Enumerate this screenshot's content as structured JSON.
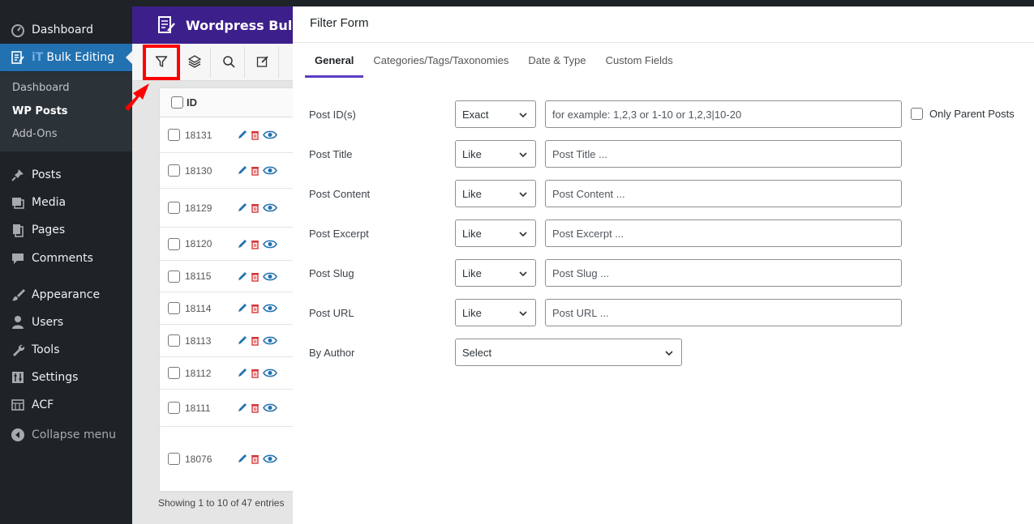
{
  "sidebar": {
    "items": [
      {
        "label": "Dashboard",
        "icon": "dashboard-icon"
      },
      {
        "badge": "iT",
        "label": "Bulk Editing",
        "icon": "bulk-edit-icon"
      },
      {
        "label": "Posts",
        "icon": "pin-icon"
      },
      {
        "label": "Media",
        "icon": "media-icon"
      },
      {
        "label": "Pages",
        "icon": "pages-icon"
      },
      {
        "label": "Comments",
        "icon": "comments-icon"
      },
      {
        "label": "Appearance",
        "icon": "brush-icon"
      },
      {
        "label": "Users",
        "icon": "user-icon"
      },
      {
        "label": "Tools",
        "icon": "wrench-icon"
      },
      {
        "label": "Settings",
        "icon": "settings-icon"
      },
      {
        "label": "ACF",
        "icon": "acf-icon"
      }
    ],
    "submenu": [
      "Dashboard",
      "WP Posts",
      "Add-Ons"
    ],
    "collapse_label": "Collapse menu"
  },
  "plugin": {
    "title": "Wordpress Bulk Po",
    "table_header": "ID",
    "rows": [
      {
        "id": "18131"
      },
      {
        "id": "18130"
      },
      {
        "id": "18129"
      },
      {
        "id": "18120"
      },
      {
        "id": "18115"
      },
      {
        "id": "18114"
      },
      {
        "id": "18113"
      },
      {
        "id": "18112"
      },
      {
        "id": "18111"
      },
      {
        "id": "18076"
      }
    ],
    "showing": "Showing 1 to 10 of 47 entries"
  },
  "modal": {
    "title": "Filter Form",
    "tabs": [
      "General",
      "Categories/Tags/Taxonomies",
      "Date & Type",
      "Custom Fields"
    ],
    "fields": [
      {
        "label": "Post ID(s)",
        "operator": "Exact",
        "placeholder": "for example: 1,2,3 or 1-10 or 1,2,3|10-20"
      },
      {
        "label": "Post Title",
        "operator": "Like",
        "placeholder": "Post Title ..."
      },
      {
        "label": "Post Content",
        "operator": "Like",
        "placeholder": "Post Content ..."
      },
      {
        "label": "Post Excerpt",
        "operator": "Like",
        "placeholder": "Post Excerpt ..."
      },
      {
        "label": "Post Slug",
        "operator": "Like",
        "placeholder": "Post Slug ..."
      },
      {
        "label": "Post URL",
        "operator": "Like",
        "placeholder": "Post URL ..."
      }
    ],
    "author": {
      "label": "By Author",
      "value": "Select"
    },
    "only_parent_label": "Only Parent Posts"
  },
  "colors": {
    "accent": "#5b3cc4",
    "wp_blue": "#2271b1",
    "highlight": "#ff0000"
  }
}
